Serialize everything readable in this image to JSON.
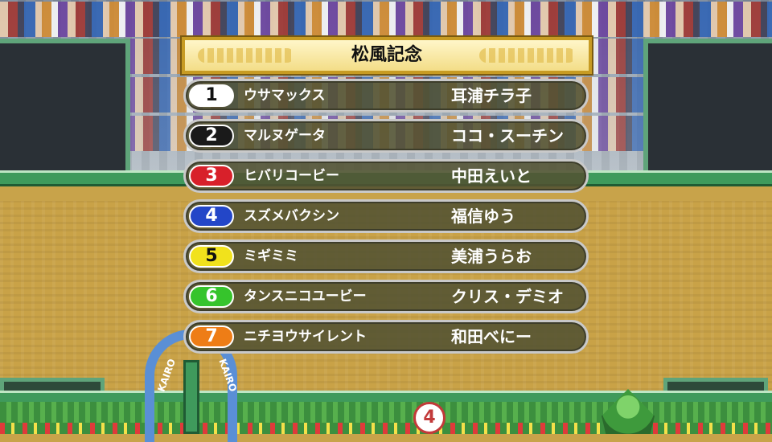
{
  "race": {
    "title": "松風記念"
  },
  "entries": [
    {
      "number": "1",
      "horse": "ウサマックス",
      "jockey": "耳浦チラ子",
      "badge_bg": "#ffffff",
      "badge_fg": "#111111"
    },
    {
      "number": "2",
      "horse": "マルヌゲータ",
      "jockey": "ココ・スーチン",
      "badge_bg": "#1a1a1a",
      "badge_fg": "#ffffff"
    },
    {
      "number": "3",
      "horse": "ヒバリコービー",
      "jockey": "中田えいと",
      "badge_bg": "#d8202a",
      "badge_fg": "#ffffff"
    },
    {
      "number": "4",
      "horse": "スズメバクシン",
      "jockey": "福信ゆう",
      "badge_bg": "#2346c8",
      "badge_fg": "#ffffff"
    },
    {
      "number": "5",
      "horse": "ミギミミ",
      "jockey": "美浦うらお",
      "badge_bg": "#f1e21c",
      "badge_fg": "#111111"
    },
    {
      "number": "6",
      "horse": "タンスニコユービー",
      "jockey": "クリス・デミオ",
      "badge_bg": "#36c42c",
      "badge_fg": "#ffffff"
    },
    {
      "number": "7",
      "horse": "ニチヨウサイレント",
      "jockey": "和田べにー",
      "badge_bg": "#ee7d16",
      "badge_fg": "#ffffff"
    }
  ],
  "scene": {
    "arch_left": "KAIRO",
    "arch_right": "KAIRO",
    "post_number": "4"
  }
}
